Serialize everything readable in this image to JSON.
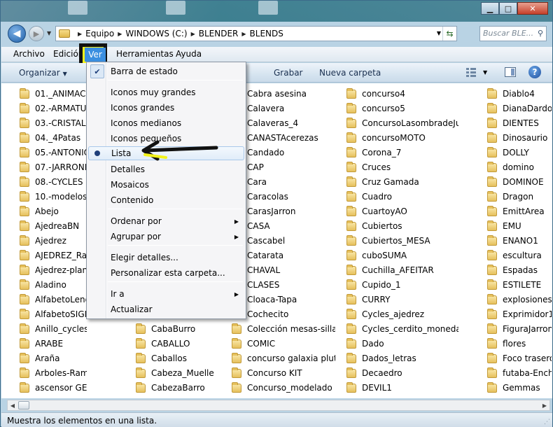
{
  "window": {
    "controls": {
      "minimize": "▁",
      "maximize": "□",
      "close": "✕"
    }
  },
  "address_bar": {
    "crumbs": [
      "Equipo",
      "WINDOWS (C:)",
      "BLENDER",
      "BLENDS"
    ],
    "search_placeholder": "Buscar BLE..."
  },
  "menubar": {
    "items": [
      "Archivo",
      "Edición",
      "Ver",
      "Herramientas",
      "Ayuda"
    ],
    "active": "Ver"
  },
  "toolbar": {
    "organize_label": "Organizar",
    "record_label": "Grabar",
    "new_folder_label": "Nueva carpeta"
  },
  "view_menu": {
    "items": [
      {
        "label": "Barra de estado",
        "state": "checked"
      },
      {
        "label": "Iconos muy grandes"
      },
      {
        "label": "Iconos grandes"
      },
      {
        "label": "Iconos medianos"
      },
      {
        "label": "Iconos pequeños"
      },
      {
        "label": "Lista",
        "state": "selected"
      },
      {
        "label": "Detalles"
      },
      {
        "label": "Mosaicos"
      },
      {
        "label": "Contenido"
      },
      {
        "label": "Ordenar por",
        "submenu": true
      },
      {
        "label": "Agrupar por",
        "submenu": true
      },
      {
        "label": "Elegir detalles..."
      },
      {
        "label": "Personalizar esta carpeta..."
      },
      {
        "label": "Ir a",
        "submenu": true
      },
      {
        "label": "Actualizar"
      }
    ]
  },
  "files": {
    "col1": [
      "01._ANIMACIO",
      "02.-ARMATURI",
      "03.-CRISTAL-B",
      "04._4Patas",
      "05.-ANTONIOS",
      "07.-JARRONES",
      "08.-CYCLES",
      "10.-modelos_b",
      "Abejo",
      "AjedreaBN",
      "Ajedrez",
      "AJEDREZ_Ra",
      "Ajedrez-plano",
      "Aladino",
      "AlfabetoLengu",
      "AlfabetoSIGNO",
      "Anillo_cycles",
      "ARABE",
      "Araña",
      "Arboles-Ramas",
      "ascensor GE"
    ],
    "col2": [
      "CabaBurro",
      "CABALLO",
      "Caballos",
      "Cabeza_Muelle",
      "CabezaBarro"
    ],
    "col3": [
      "Cabra asesina",
      "Calavera",
      "Calaveras_4",
      "CANASTAcerezas",
      "Candado",
      "CAP",
      "Cara",
      "Caracolas",
      "CarasJarron",
      "CASA",
      "Cascabel",
      "Catarata",
      "CHAVAL",
      "CLASES",
      "Cloaca-Tapa",
      "Cochecito",
      "Colección mesas-sillas",
      "COMIC",
      "concurso galaxia pluton",
      "Concurso KIT",
      "Concurso_modelado"
    ],
    "col4": [
      "concurso4",
      "concurso5",
      "ConcursoLasombradeJusticia",
      "concursoMOTO",
      "Corona_7",
      "Cruces",
      "Cruz Gamada",
      "Cuadro",
      "CuartoyAO",
      "Cubiertos",
      "Cubiertos_MESA",
      "cuboSUMA",
      "Cuchilla_AFEITAR",
      "Cupido_1",
      "CURRY",
      "Cycles_ajedrez",
      "Cycles_cerdito_monedas",
      "Dado",
      "Dados_letras",
      "Decaedro",
      "DEVIL1"
    ],
    "col5": [
      "Diablo4",
      "DianaDardos",
      "DIENTES",
      "Dinosaurio",
      "DOLLY",
      "domino",
      "DOMINOE",
      "Dragon",
      "EmittArea",
      "EMU",
      "ENANO1",
      "escultura",
      "Espadas",
      "ESTILETE",
      "explosiones",
      "Exprimidor1",
      "FiguraJarroncit",
      "flores",
      "Foco trasero",
      "futaba-Enchuf",
      "Gemmas"
    ]
  },
  "status_bar": {
    "text": "Muestra los elementos en una lista."
  },
  "colors": {
    "annotation_yellow": "#f2f21a",
    "menu_highlight": "#3b8fe0"
  }
}
